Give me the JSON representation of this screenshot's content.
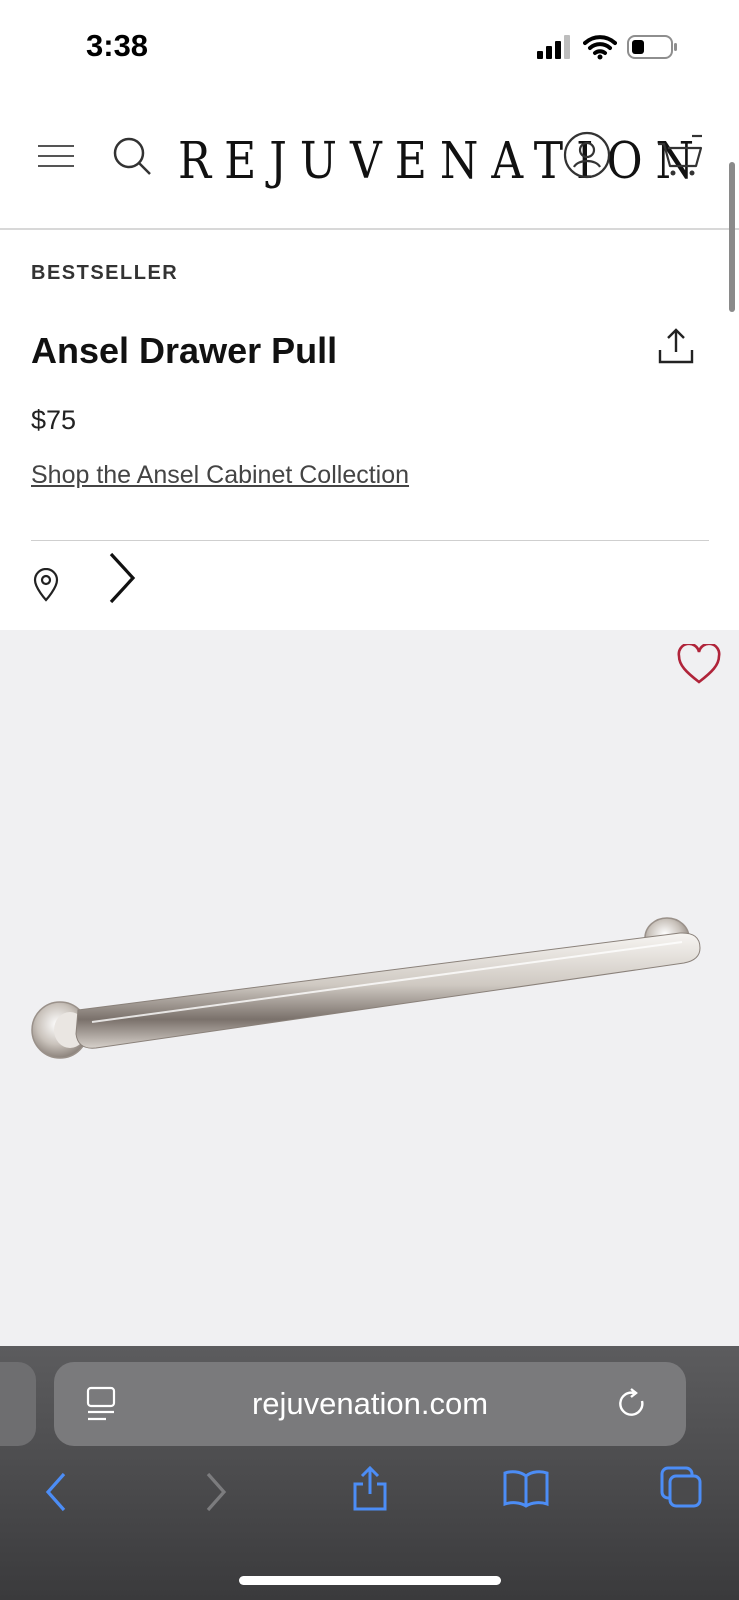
{
  "status_bar": {
    "time": "3:38"
  },
  "header": {
    "logo": "REJUVENATION",
    "icons": [
      "menu-icon",
      "search-icon",
      "account-icon",
      "cart-icon"
    ]
  },
  "product": {
    "badge": "BESTSELLER",
    "title": "Ansel Drawer Pull",
    "price": "$75",
    "collection_link": "Shop the Ansel Cabinet Collection"
  },
  "colors": {
    "favorite": "#b0243a",
    "browser_accent": "#4c8df6",
    "product_bg": "#f0f0f2"
  },
  "browser": {
    "url": "rejuvenation.com"
  }
}
